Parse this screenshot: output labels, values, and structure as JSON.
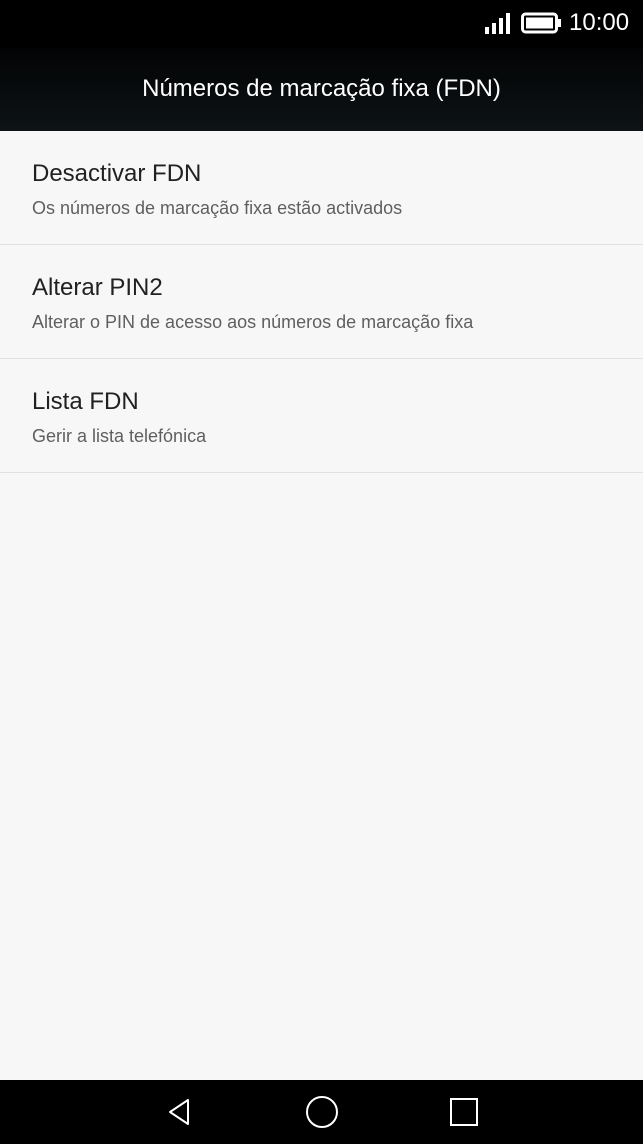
{
  "status_bar": {
    "time": "10:00",
    "icons": [
      "signal-icon",
      "battery-icon"
    ]
  },
  "header": {
    "title": "Números de marcação fixa (FDN)"
  },
  "settings": {
    "items": [
      {
        "title": "Desactivar FDN",
        "subtitle": "Os números de marcação fixa estão activados"
      },
      {
        "title": "Alterar PIN2",
        "subtitle": "Alterar o PIN de acesso aos números de marcação fixa"
      },
      {
        "title": "Lista FDN",
        "subtitle": "Gerir a lista telefónica"
      }
    ]
  },
  "navigation": {
    "icons": [
      "back-icon",
      "home-icon",
      "recents-icon"
    ]
  },
  "colors": {
    "app_bar": "#0e1316",
    "background": "#f7f7f7",
    "primary_text": "#212121",
    "secondary_text": "#5f5f5f",
    "divider": "#e2e2e2"
  }
}
